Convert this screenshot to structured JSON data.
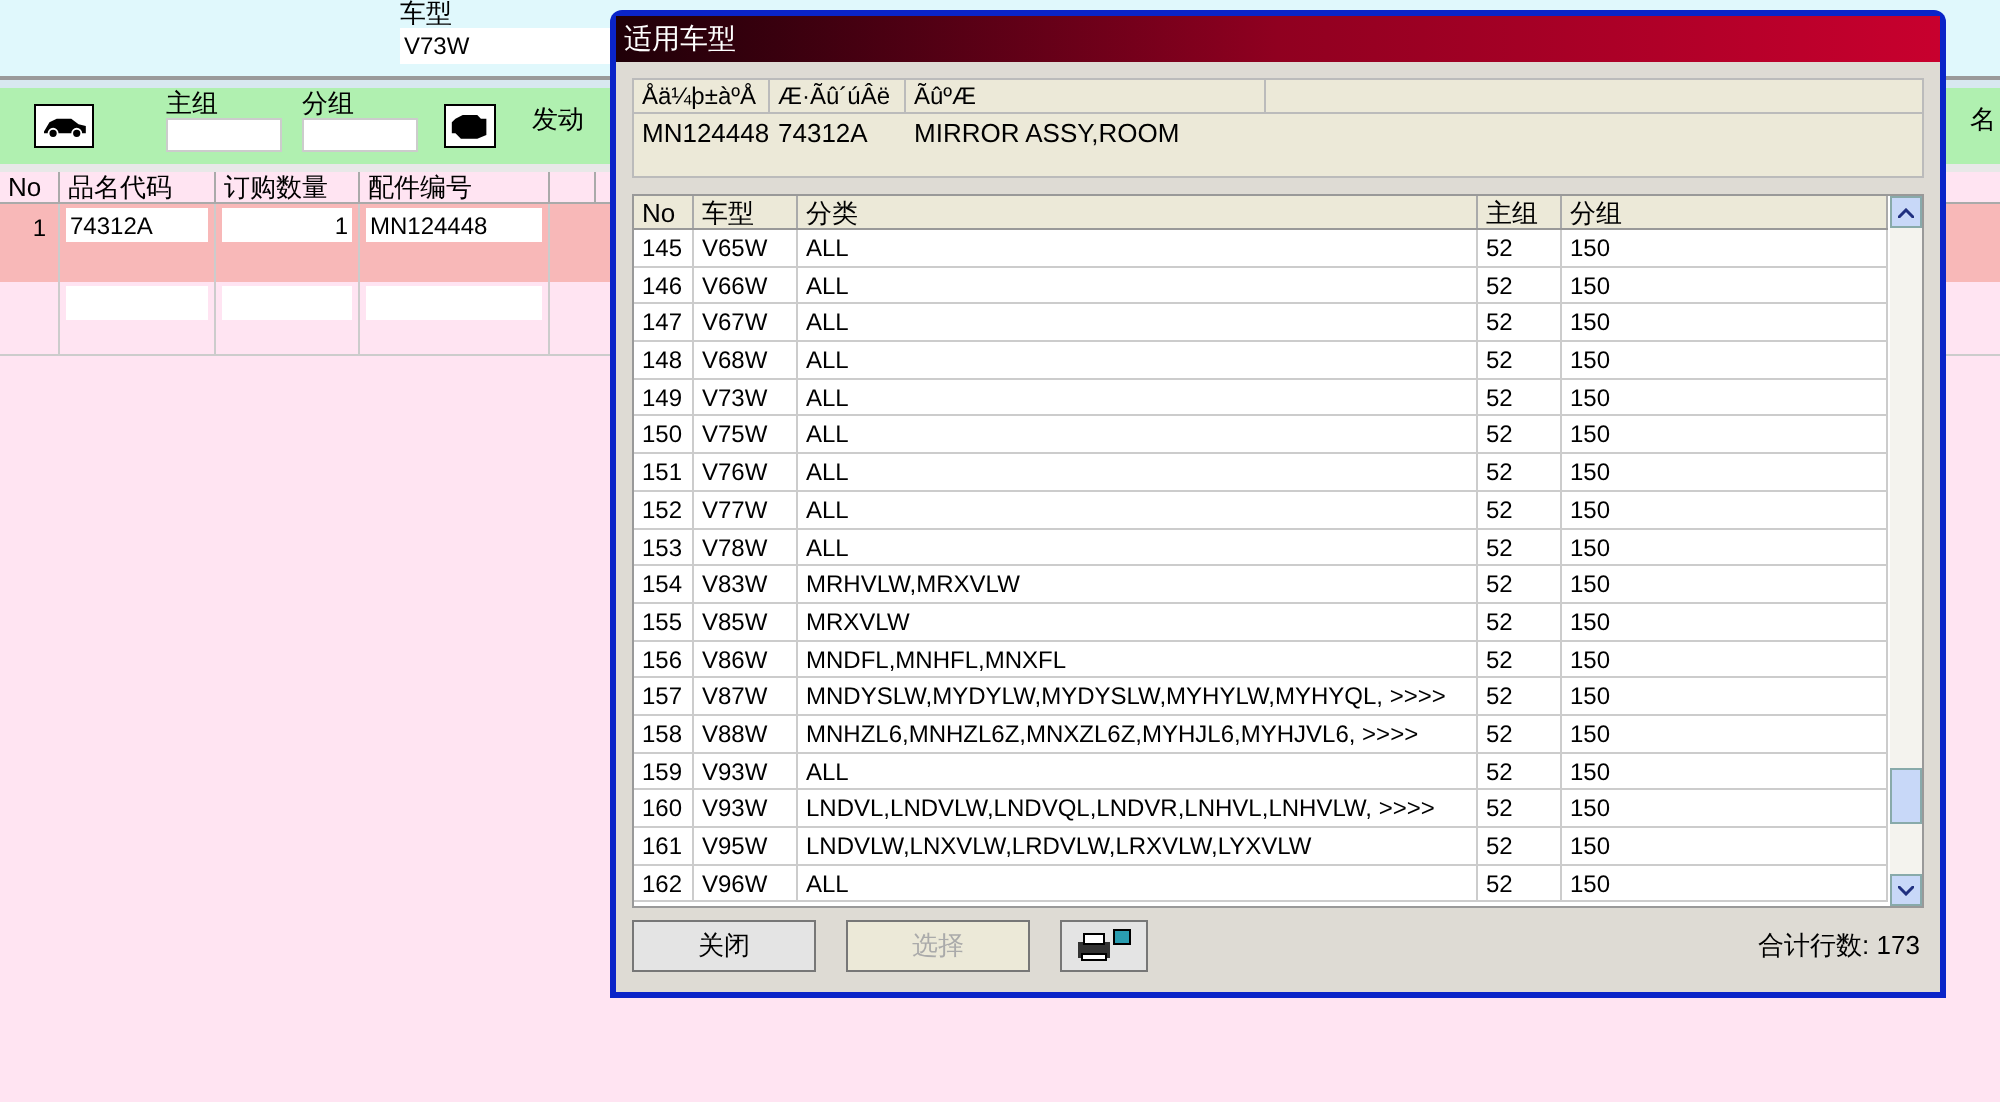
{
  "background": {
    "vehicle_label": "车型",
    "vehicle_value": "V73W",
    "main_group_label": "主组",
    "sub_group_label": "分组",
    "engine_label": "发动",
    "right_label": "名",
    "columns": [
      "No",
      "品名代码",
      "订购数量",
      "配件编号"
    ],
    "rows": [
      {
        "no": "1",
        "code": "74312A",
        "qty": "1",
        "part": "MN124448",
        "selected": true
      }
    ]
  },
  "dialog": {
    "title": "适用车型",
    "info_columns": [
      "Åä¼þ±àºÅ",
      "Æ·Ãû´úÂë",
      "ÃûºÆ"
    ],
    "info_row": [
      "MN124448",
      "74312A",
      "MIRROR ASSY,ROOM"
    ],
    "columns": [
      "No",
      "车型",
      "分类",
      "主组",
      "分组"
    ],
    "rows": [
      [
        "145",
        "V65W",
        "ALL",
        "52",
        "150"
      ],
      [
        "146",
        "V66W",
        "ALL",
        "52",
        "150"
      ],
      [
        "147",
        "V67W",
        "ALL",
        "52",
        "150"
      ],
      [
        "148",
        "V68W",
        "ALL",
        "52",
        "150"
      ],
      [
        "149",
        "V73W",
        "ALL",
        "52",
        "150"
      ],
      [
        "150",
        "V75W",
        "ALL",
        "52",
        "150"
      ],
      [
        "151",
        "V76W",
        "ALL",
        "52",
        "150"
      ],
      [
        "152",
        "V77W",
        "ALL",
        "52",
        "150"
      ],
      [
        "153",
        "V78W",
        "ALL",
        "52",
        "150"
      ],
      [
        "154",
        "V83W",
        "MRHVLW,MRXVLW",
        "52",
        "150"
      ],
      [
        "155",
        "V85W",
        "MRXVLW",
        "52",
        "150"
      ],
      [
        "156",
        "V86W",
        "MNDFL,MNHFL,MNXFL",
        "52",
        "150"
      ],
      [
        "157",
        "V87W",
        "MNDYSLW,MYDYLW,MYDYSLW,MYHYLW,MYHYQL,  >>>>",
        "52",
        "150"
      ],
      [
        "158",
        "V88W",
        "MNHZL6,MNHZL6Z,MNXZL6Z,MYHJL6,MYHJVL6,  >>>>",
        "52",
        "150"
      ],
      [
        "159",
        "V93W",
        "ALL",
        "52",
        "150"
      ],
      [
        "160",
        "V93W",
        "LNDVL,LNDVLW,LNDVQL,LNDVR,LNHVL,LNHVLW,  >>>>",
        "52",
        "150"
      ],
      [
        "161",
        "V95W",
        "LNDVLW,LNXVLW,LRDVLW,LRXVLW,LYXVLW",
        "52",
        "150"
      ],
      [
        "162",
        "V96W",
        "ALL",
        "52",
        "150"
      ]
    ],
    "buttons": [
      {
        "label": "关闭",
        "disabled": false
      },
      {
        "label": "选择",
        "disabled": true
      }
    ],
    "total_label": "合计行数:",
    "total": "173"
  }
}
